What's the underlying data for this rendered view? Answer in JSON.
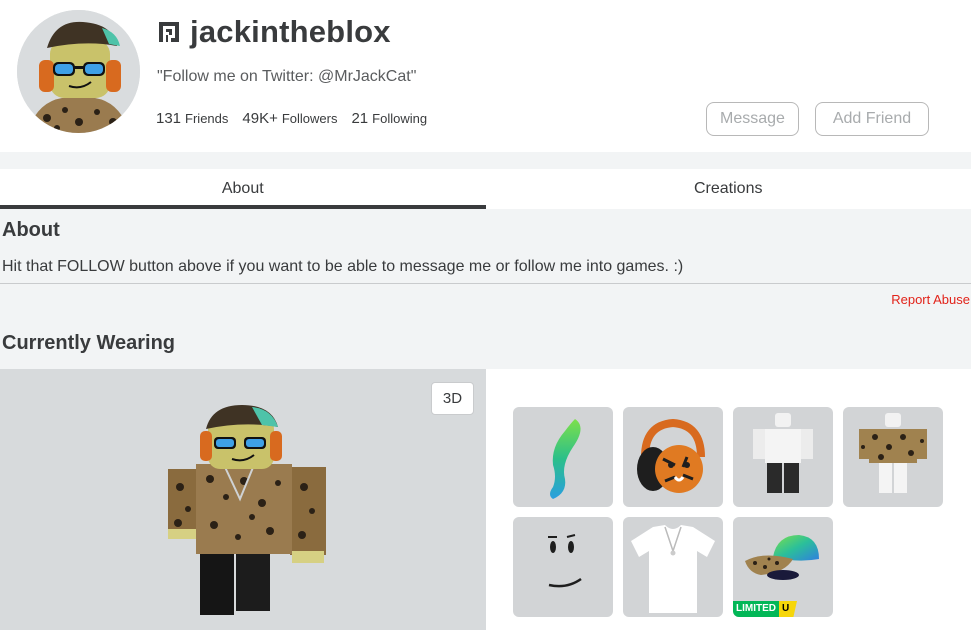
{
  "profile": {
    "username": "jackintheblox",
    "status": "\"Follow me on Twitter: @MrJackCat\"",
    "stats": {
      "friends_count": "131",
      "friends_label": "Friends",
      "followers_count": "49K+",
      "followers_label": "Followers",
      "following_count": "21",
      "following_label": "Following"
    },
    "buttons": {
      "message": "Message",
      "add_friend": "Add Friend"
    }
  },
  "tabs": [
    {
      "label": "About",
      "active": true
    },
    {
      "label": "Creations",
      "active": false
    }
  ],
  "about": {
    "title": "About",
    "text": "Hit that FOLLOW button above if you want to be able to message me or follow me into games. :)",
    "report": "Report Abuse"
  },
  "wearing": {
    "title": "Currently Wearing",
    "view_toggle": "3D",
    "items": [
      {
        "icon": "green-tail-icon"
      },
      {
        "icon": "tiger-headphones-icon"
      },
      {
        "icon": "white-shirt-outfit-icon"
      },
      {
        "icon": "leopard-outfit-icon"
      },
      {
        "icon": "smile-face-icon"
      },
      {
        "icon": "white-tshirt-chain-icon"
      },
      {
        "icon": "leopard-cap-icon",
        "badge": "LIMITED",
        "badge_u": "U"
      }
    ]
  },
  "colors": {
    "accent_dark": "#393b3d",
    "report": "#e2231a",
    "limited_green": "#02b757",
    "limited_yellow": "#f6d60b"
  }
}
